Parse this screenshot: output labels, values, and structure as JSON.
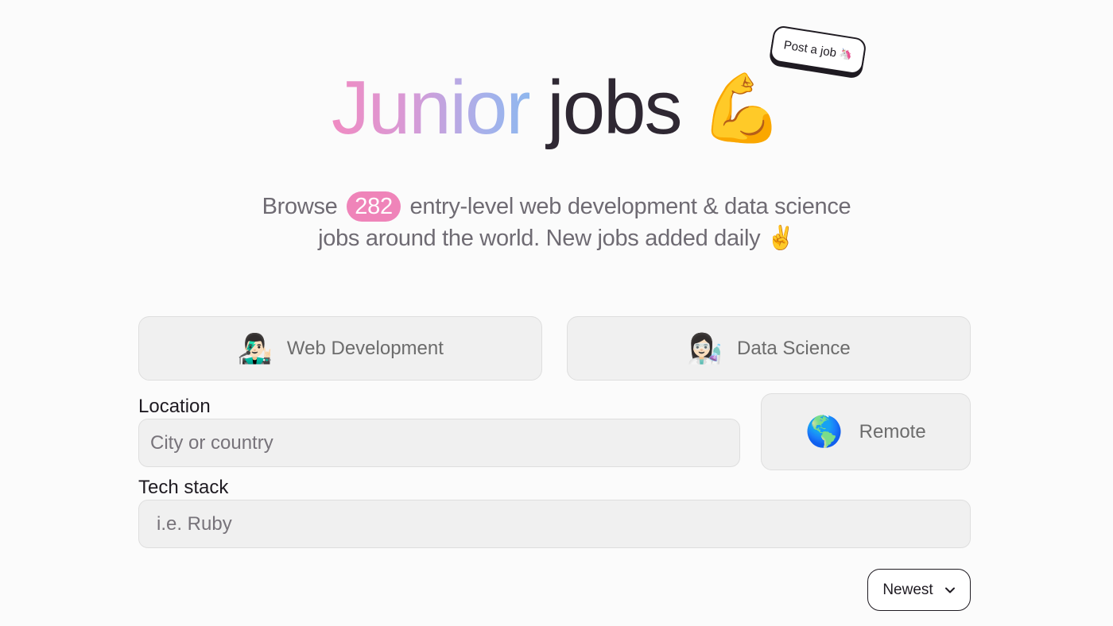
{
  "post_job": {
    "label": "Post a job",
    "icon": "unicorn-icon",
    "emoji": "🦄"
  },
  "hero": {
    "title_part1": "Junior",
    "title_part2": "jobs",
    "emoji": "💪",
    "gradient_colors": [
      "#f08bc2",
      "#8fb7ee"
    ]
  },
  "subtitle": {
    "before_count": "Browse",
    "count": "282",
    "after_count": "entry-level web development & data science",
    "line2": "jobs around the world. New jobs added daily",
    "emoji": "✌️",
    "badge_color": "#ef84b9"
  },
  "categories": [
    {
      "label": "Web Development",
      "emoji": "👨🏻‍🎤",
      "icon": "rockstar-icon"
    },
    {
      "label": "Data Science",
      "emoji": "👩🏻‍🔬",
      "icon": "scientist-icon"
    }
  ],
  "location": {
    "label": "Location",
    "placeholder": "City or country",
    "value": ""
  },
  "remote": {
    "label": "Remote",
    "emoji": "🌎",
    "icon": "globe-icon"
  },
  "tech_stack": {
    "label": "Tech stack",
    "placeholder": "i.e. Ruby",
    "value": ""
  },
  "sort": {
    "selected": "Newest",
    "icon": "chevron-down-icon"
  }
}
